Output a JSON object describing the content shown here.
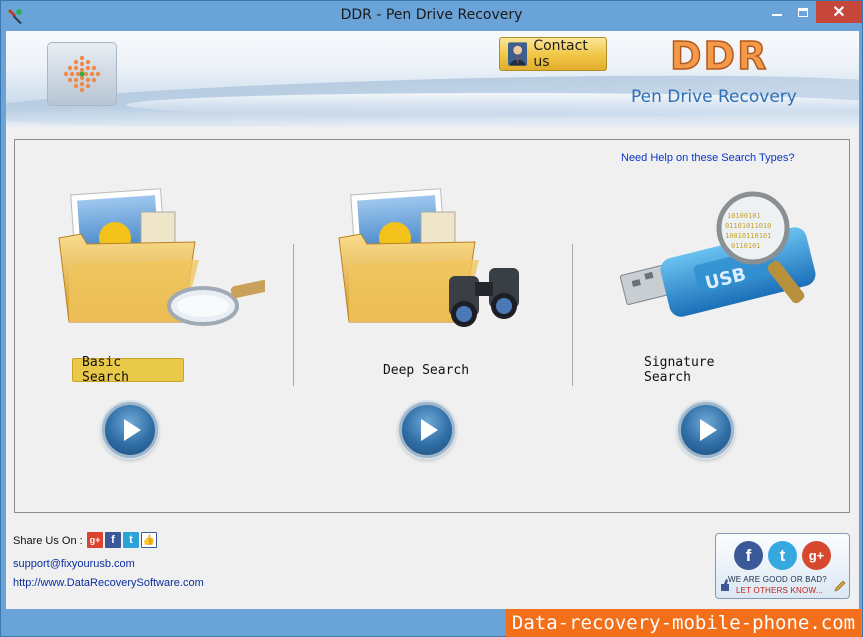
{
  "window": {
    "title": "DDR - Pen Drive Recovery"
  },
  "header": {
    "contact_label": "Contact us",
    "brand": "DDR",
    "brand_subtitle": "Pen Drive Recovery"
  },
  "main": {
    "help_link": "Need Help on these Search Types?",
    "options": [
      {
        "label": "Basic Search",
        "selected": true
      },
      {
        "label": "Deep Search",
        "selected": false
      },
      {
        "label": "Signature Search",
        "selected": false
      }
    ]
  },
  "footer": {
    "share_label": "Share Us On :",
    "email": "support@fixyourusb.com",
    "website": "http://www.DataRecoverySoftware.com",
    "feedback_line1": "WE ARE GOOD OR BAD?",
    "feedback_line2": "LET OTHERS KNOW...",
    "watermark": "Data-recovery-mobile-phone.com"
  },
  "icons": {
    "app": "pen-drive-app-icon",
    "logo": "ddr-dot-logo-icon",
    "contact": "person-icon",
    "basic": "folder-magnifier-icon",
    "deep": "folder-binoculars-icon",
    "signature": "usb-magnifier-icon",
    "play": "play-icon"
  },
  "colors": {
    "accent_selected": "#e9c94a",
    "brand_orange": "#f39a4a",
    "brand_blue": "#2f6fb6",
    "link_blue": "#0a35c8",
    "close_red": "#c7463a",
    "watermark_orange": "#f36f19"
  }
}
